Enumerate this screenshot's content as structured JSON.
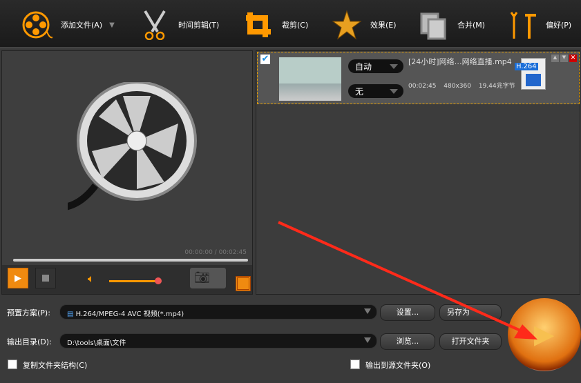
{
  "toolbar": {
    "items": [
      {
        "label": "添加文件(A)",
        "icon": "film-reel-icon"
      },
      {
        "label": "时间剪辑(T)",
        "icon": "scissors-icon"
      },
      {
        "label": "裁剪(C)",
        "icon": "crop-icon"
      },
      {
        "label": "效果(E)",
        "icon": "star-icon"
      },
      {
        "label": "合并(M)",
        "icon": "merge-icon"
      },
      {
        "label": "偏好(P)",
        "icon": "tools-icon"
      }
    ]
  },
  "preview": {
    "time": "00:00:00 / 00:02:45",
    "volume": 0.9
  },
  "file": {
    "name": "[24小时]网络…网络直播.mp4",
    "audio": "自动",
    "subtitle": "无",
    "duration": "00:02:45",
    "resolution": "480x360",
    "size": "19.44兆字节",
    "codec": "H.264",
    "checked": true
  },
  "bottom": {
    "preset_label": "预置方案(P):",
    "preset_value": "H.264/MPEG-4 AVC 视频(*.mp4)",
    "settings": "设置...",
    "save_as": "另存为",
    "output_label": "输出目录(D):",
    "output_value": "D:\\tools\\桌面\\文件",
    "browse": "浏览...",
    "open_folder": "打开文件夹",
    "copy_structure": "复制文件夹结构(C)",
    "output_to_source": "输出到源文件夹(O)"
  },
  "colors": {
    "accent": "#f08a10",
    "annotation": "#ff2a1a"
  }
}
